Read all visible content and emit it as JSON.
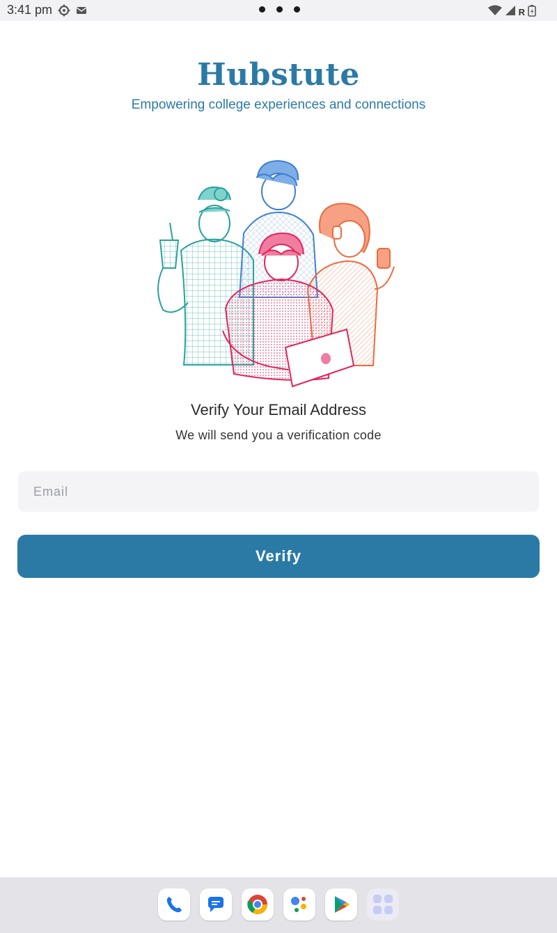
{
  "status_bar": {
    "time": "3:41 pm",
    "left_icons": [
      "settings-icon",
      "mail-icon"
    ],
    "right_icons": [
      "wifi-icon",
      "signal-icon",
      "battery-icon"
    ],
    "roaming": "R"
  },
  "header": {
    "title": "Hubstute",
    "tagline": "Empowering college experiences and connections"
  },
  "main": {
    "heading": "Verify Your Email Address",
    "subheading": "We will send you a verification code",
    "email_placeholder": "Email",
    "email_value": "",
    "verify_label": "Verify"
  },
  "dock": {
    "apps": [
      "phone-app-icon",
      "messages-app-icon",
      "chrome-app-icon",
      "assistant-app-icon",
      "play-store-app-icon",
      "app-drawer-icon"
    ]
  },
  "colors": {
    "brand": "#2b7aa6",
    "field_bg": "#f4f4f6",
    "dock_bg": "#e4e3e8"
  }
}
